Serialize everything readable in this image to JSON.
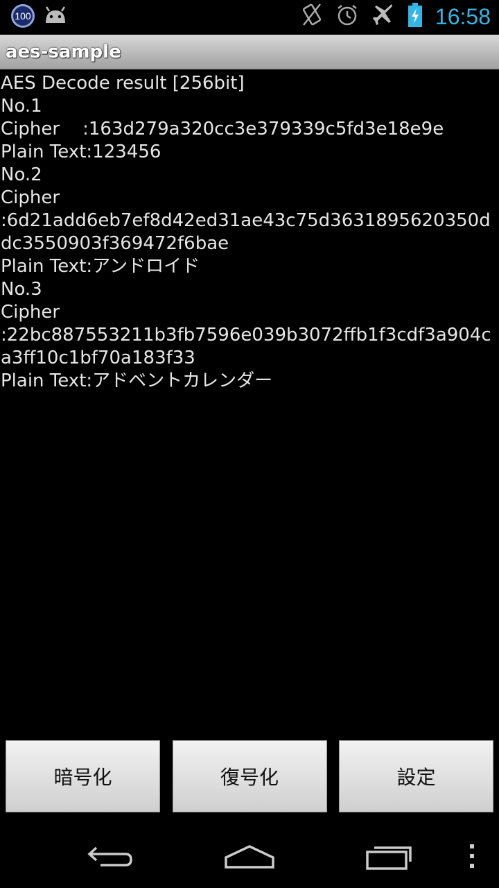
{
  "status_bar": {
    "notification_count": "100",
    "time": "16:58",
    "icons": [
      "badge-100-icon",
      "android-icon",
      "vibrate-icon",
      "alarm-icon",
      "airplane-icon",
      "battery-charging-icon"
    ]
  },
  "app": {
    "title": "aes-sample"
  },
  "result": {
    "header": "AES Decode result [256bit]",
    "entries": [
      {
        "number": "No.1",
        "cipher_line": "Cipher    :163d279a320cc3e379339c5fd3e18e9e",
        "plain": "Plain Text:123456"
      },
      {
        "number": "No.2",
        "cipher_label": "Cipher",
        "cipher_value": ":6d21add6eb7ef8d42ed31ae43c75d3631895620350ddc3550903f369472f6bae",
        "plain": "Plain Text:アンドロイド"
      },
      {
        "number": "No.3",
        "cipher_label": "Cipher",
        "cipher_value": ":22bc887553211b3fb7596e039b3072ffb1f3cdf3a904ca3ff10c1bf70a183f33",
        "plain": "Plain Text:アドベントカレンダー"
      }
    ]
  },
  "buttons": {
    "encrypt": "暗号化",
    "decrypt": "復号化",
    "settings": "設定"
  },
  "nav": {
    "icons": [
      "back-icon",
      "home-icon",
      "recent-apps-icon",
      "menu-icon"
    ]
  },
  "colors": {
    "background": "#000000",
    "clock": "#33b5e5",
    "text": "#e6e6e6"
  }
}
